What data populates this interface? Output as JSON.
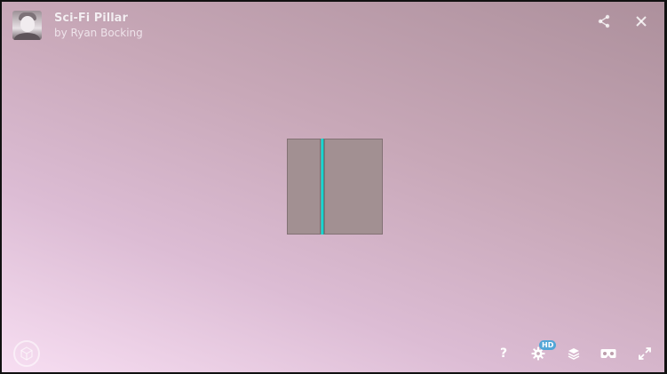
{
  "window": {
    "model_title": "Sci-Fi Pillar",
    "author_line": "by Ryan Bocking"
  },
  "icons": {
    "avatar": "avatar-image",
    "share": "share-icon",
    "close": "close-icon",
    "logo": "sketchfab-logo-icon",
    "help": "help-icon",
    "settings": "gear-icon",
    "layers": "layers-icon",
    "vr": "vr-headset-icon",
    "fullscreen": "fullscreen-icon"
  },
  "toolbar": {
    "help_label": "?",
    "hd_badge": "HD"
  },
  "colors": {
    "background_light": "#f7def2",
    "background_dark": "#ad909c",
    "pillar_panel": "#a29092",
    "seam_glow": "#17e7e0",
    "hd_badge": "#52a6d7"
  }
}
